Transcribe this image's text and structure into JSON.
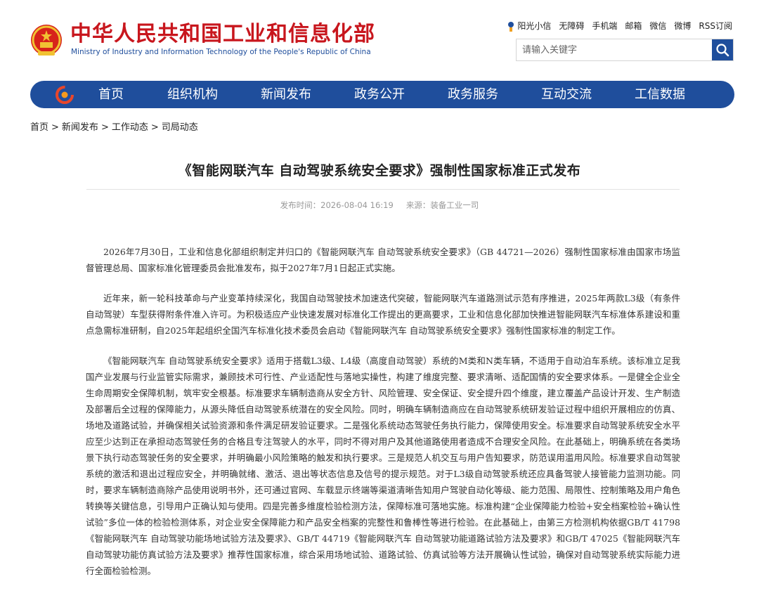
{
  "site": {
    "title": "中华人民共和国工业和信息化部",
    "subtitle": "Ministry of Industry and Information Technology of the People's Republic of China"
  },
  "toplinks": [
    "阳光小信",
    "无障碍",
    "手机端",
    "邮箱",
    "微信",
    "微博",
    "RSS订阅"
  ],
  "search": {
    "placeholder": "请输入关键字"
  },
  "nav": [
    "首页",
    "组织机构",
    "新闻发布",
    "政务公开",
    "政务服务",
    "互动交流",
    "工信数据"
  ],
  "breadcrumb": [
    "首页",
    "新闻发布",
    "工作动态",
    "司局动态"
  ],
  "article": {
    "title": "《智能网联汽车 自动驾驶系统安全要求》强制性国家标准正式发布",
    "publish_time": "发布时间：2026-08-04 16:19",
    "source": "来源：装备工业一司",
    "paragraphs": [
      "2026年7月30日，工业和信息化部组织制定并归口的《智能网联汽车 自动驾驶系统安全要求》（GB 44721—2026）强制性国家标准由国家市场监督管理总局、国家标准化管理委员会批准发布，拟于2027年7月1日起正式实施。",
      "近年来，新一轮科技革命与产业变革持续深化，我国自动驾驶技术加速迭代突破，智能网联汽车道路测试示范有序推进，2025年两款L3级（有条件自动驾驶）车型获得附条件准入许可。为积极适应产业快速发展对标准化工作提出的更高要求，工业和信息化部加快推进智能网联汽车标准体系建设和重点急需标准研制，自2025年起组织全国汽车标准化技术委员会启动《智能网联汽车 自动驾驶系统安全要求》强制性国家标准的制定工作。",
      "《智能网联汽车 自动驾驶系统安全要求》适用于搭载L3级、L4级（高度自动驾驶）系统的M类和N类车辆，不适用于自动泊车系统。该标准立足我国产业发展与行业监管实际需求，兼顾技术可行性、产业适配性与落地实操性，构建了维度完整、要求清晰、适配国情的安全要求体系。一是健全企业全生命周期安全保障机制，筑牢安全根基。标准要求车辆制造商从安全方针、风险管理、安全保证、安全提升四个维度，建立覆盖产品设计开发、生产制造及部署后全过程的保障能力，从源头降低自动驾驶系统潜在的安全风险。同时，明确车辆制造商应在自动驾驶系统研发验证过程中组织开展相应的仿真、场地及道路试验，并确保相关试验资源和条件满足研发验证要求。二是强化系统动态驾驶任务执行能力，保障使用安全。标准要求自动驾驶系统安全水平应至少达到正在承担动态驾驶任务的合格且专注驾驶人的水平，同时不得对用户及其他道路使用者造成不合理安全风险。在此基础上，明确系统在各类场景下执行动态驾驶任务的安全要求，并明确最小风险策略的触发和执行要求。三是规范人机交互与用户告知要求，防范误用滥用风险。标准要求自动驾驶系统的激活和退出过程应安全，并明确就绪、激活、退出等状态信息及信号的提示规范。对于L3级自动驾驶系统还应具备驾驶人接管能力监测功能。同时，要求车辆制造商除产品使用说明书外，还可通过官网、车载显示终端等渠道清晰告知用户驾驶自动化等级、能力范围、局限性、控制策略及用户角色转换等关键信息，引导用户正确认知与使用。四是完善多维度检验检测方法，保障标准可落地实施。标准构建“企业保障能力检验+安全档案检验+确认性试验”多位一体的检验检测体系，对企业安全保障能力和产品安全档案的完整性和鲁棒性等进行检验。在此基础上，由第三方检测机构依据GB/T 41798《智能网联汽车 自动驾驶功能场地试验方法及要求》、GB/T 44719《智能网联汽车 自动驾驶功能道路试验方法及要求》和GB/T 47025《智能网联汽车 自动驾驶功能仿真试验方法及要求》推荐性国家标准，综合采用场地试验、道路试验、仿真试验等方法开展确认性试验，确保对自动驾驶系统实际能力进行全面检验检测。"
    ]
  },
  "colors": {
    "brand_red": "#c8161d",
    "brand_blue": "#1f4e9c"
  }
}
